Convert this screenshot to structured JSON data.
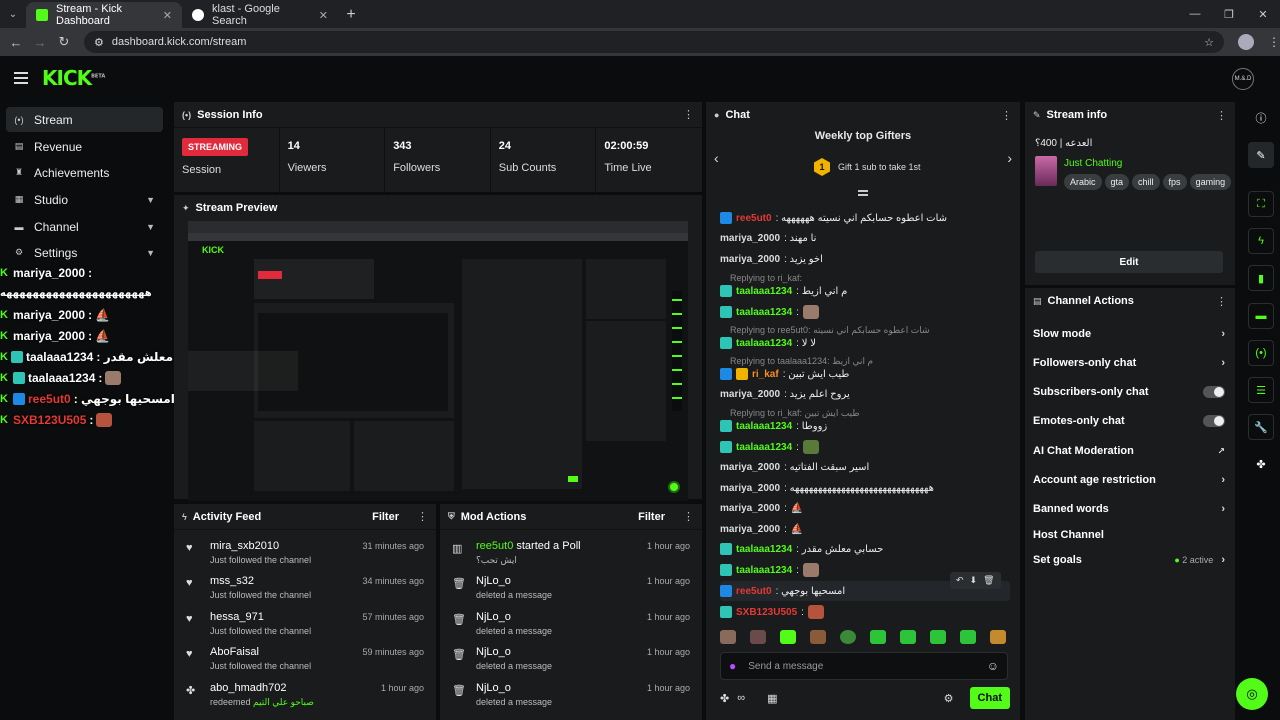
{
  "browser": {
    "tabs": [
      {
        "title": "Stream - Kick Dashboard",
        "active": true
      },
      {
        "title": "klast - Google Search",
        "active": false
      }
    ],
    "url": "dashboard.kick.com/stream"
  },
  "topbar": {
    "logo": "KICK",
    "logo_badge": "BETA",
    "avatar": "M.&.D"
  },
  "sidebar": {
    "items": [
      {
        "label": "Stream",
        "icon": "stream-icon",
        "active": true
      },
      {
        "label": "Revenue",
        "icon": "revenue-icon"
      },
      {
        "label": "Achievements",
        "icon": "trophy-icon"
      },
      {
        "label": "Studio",
        "icon": "studio-icon",
        "expandable": true
      },
      {
        "label": "Channel",
        "icon": "channel-icon",
        "expandable": true
      },
      {
        "label": "Settings",
        "icon": "gear-icon",
        "expandable": true
      }
    ]
  },
  "overlay_chat": [
    {
      "name": "mariya_2000",
      "msg": ":"
    },
    {
      "name": "",
      "msg": "ههههههههههههههههههههههه"
    },
    {
      "name": "mariya_2000",
      "msg": ":"
    },
    {
      "name": "mariya_2000",
      "msg": ":"
    },
    {
      "name": "taalaaa1234",
      "msg": ": حسابي معلش مقدر"
    },
    {
      "name": "taalaaa1234",
      "msg": ":"
    },
    {
      "name": "ree5ut0",
      "msg": ": امسحيها بوجهي"
    },
    {
      "name": "SXB123U505",
      "msg": ":"
    }
  ],
  "session_info": {
    "title": "Session Info",
    "status": "STREAMING",
    "session_label": "Session",
    "stats": [
      {
        "value": "14",
        "label": "Viewers"
      },
      {
        "value": "343",
        "label": "Followers"
      },
      {
        "value": "24",
        "label": "Sub Counts"
      },
      {
        "value": "02:00:59",
        "label": "Time Live"
      }
    ]
  },
  "stream_preview": {
    "title": "Stream Preview"
  },
  "activity_feed": {
    "title": "Activity Feed",
    "filter": "Filter",
    "items": [
      {
        "name": "mira_sxb2010",
        "sub": "Just followed the channel",
        "time": "31 minutes ago",
        "icon": "heart-icon"
      },
      {
        "name": "mss_s32",
        "sub": "Just followed the channel",
        "time": "34 minutes ago",
        "icon": "heart-icon"
      },
      {
        "name": "hessa_971",
        "sub": "Just followed the channel",
        "time": "57 minutes ago",
        "icon": "heart-icon"
      },
      {
        "name": "AboFaisal",
        "sub": "Just followed the channel",
        "time": "59 minutes ago",
        "icon": "heart-icon"
      },
      {
        "name": "abo_hmadh702",
        "sub": "redeemed",
        "sub2": "صباحو علي التيم",
        "time": "1 hour ago",
        "icon": "points-icon"
      }
    ]
  },
  "mod_actions": {
    "title": "Mod Actions",
    "filter": "Filter",
    "items": [
      {
        "name": "ree5ut0",
        "action": "started a Poll",
        "sub": "ايش تحب؟",
        "time": "1 hour ago",
        "icon": "poll-icon"
      },
      {
        "name": "NjLo_o",
        "sub": "deleted a message",
        "time": "1 hour ago",
        "icon": "trash-icon"
      },
      {
        "name": "NjLo_o",
        "sub": "deleted a message",
        "time": "1 hour ago",
        "icon": "trash-icon"
      },
      {
        "name": "NjLo_o",
        "sub": "deleted a message",
        "time": "1 hour ago",
        "icon": "trash-icon"
      },
      {
        "name": "NjLo_o",
        "sub": "deleted a message",
        "time": "1 hour ago",
        "icon": "trash-icon"
      }
    ]
  },
  "chat": {
    "title": "Chat",
    "gifters_title": "Weekly top Gifters",
    "gifters_rank": "1",
    "gifters_text": "Gift 1 sub to take 1st",
    "messages": [
      {
        "name": "ree5ut0",
        "color": "red",
        "text": ": شات اعطوه حسابكم اني نسيته ههههههه"
      },
      {
        "name": "mariya_2000",
        "color": "plain",
        "text": ": نا مهند"
      },
      {
        "name": "mariya_2000",
        "color": "plain",
        "text": ": اخو يزيد"
      },
      {
        "name": "taalaaa1234",
        "color": "green",
        "text": ": م اني ازيط",
        "reply": "Replying to ri_kaf:"
      },
      {
        "name": "taalaaa1234",
        "color": "green",
        "text": ":"
      },
      {
        "name": "taalaaa1234",
        "color": "green",
        "text": ": لا لا",
        "reply": "Replying to ree5ut0: شات اعطوه حسابكم اني نسيته"
      },
      {
        "name": "ri_kaf",
        "color": "orange",
        "text": ": طيب ايش تبين",
        "reply": "Replying to taalaaa1234: م اني ازيط"
      },
      {
        "name": "mariya_2000",
        "color": "plain",
        "text": ": يروح اعلم يزيد"
      },
      {
        "name": "taalaaa1234",
        "color": "green",
        "text": ": زووطا",
        "reply": "Replying to ri_kaf: طيب ايش تبين"
      },
      {
        "name": "taalaaa1234",
        "color": "green",
        "text": ":"
      },
      {
        "name": "mariya_2000",
        "color": "plain",
        "text": ": اسير سبقت الفتاتيه"
      },
      {
        "name": "mariya_2000",
        "color": "plain",
        "text": ": ههههههههههههههههههههههههههههههه"
      },
      {
        "name": "mariya_2000",
        "color": "plain",
        "text": ":"
      },
      {
        "name": "mariya_2000",
        "color": "plain",
        "text": ":"
      },
      {
        "name": "taalaaa1234",
        "color": "green",
        "text": ": حسابي معلش مقدر"
      },
      {
        "name": "taalaaa1234",
        "color": "green",
        "text": ":"
      },
      {
        "name": "ree5ut0",
        "color": "red",
        "text": ": امسحيها بوجهي"
      },
      {
        "name": "SXB123U505",
        "color": "red",
        "text": ":"
      }
    ],
    "input_placeholder": "Send a message",
    "send_label": "Chat"
  },
  "stream_info": {
    "title": "Stream info",
    "stream_title": "العدعه | 400؟",
    "category": "Just Chatting",
    "tags": [
      "Arabic",
      "gta",
      "chill",
      "fps",
      "gaming"
    ],
    "edit_label": "Edit"
  },
  "channel_actions": {
    "title": "Channel Actions",
    "items": [
      {
        "label": "Slow mode",
        "control": "chevron"
      },
      {
        "label": "Followers-only chat",
        "control": "chevron"
      },
      {
        "label": "Subscribers-only chat",
        "control": "toggle"
      },
      {
        "label": "Emotes-only chat",
        "control": "toggle"
      },
      {
        "label": "AI Chat Moderation",
        "control": "external"
      },
      {
        "label": "Account age restriction",
        "control": "chevron"
      },
      {
        "label": "Banned words",
        "control": "chevron"
      },
      {
        "label": "Host Channel",
        "control": "none"
      },
      {
        "label": "Set goals",
        "control": "chevron",
        "status": "2 active"
      }
    ]
  },
  "colors": {
    "accent": "#53fc18",
    "live": "#e12a3c",
    "panel": "#191b1d",
    "bg": "#0b0c0d"
  }
}
